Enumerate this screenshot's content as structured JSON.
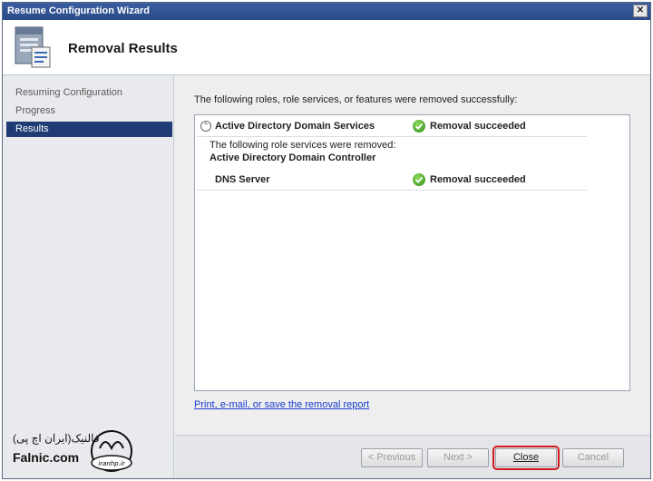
{
  "window": {
    "title": "Resume Configuration Wizard",
    "close_glyph": "✕"
  },
  "header": {
    "title": "Removal Results",
    "icon": "server-wizard-icon"
  },
  "sidebar": {
    "items": [
      {
        "label": "Resuming Configuration",
        "active": false
      },
      {
        "label": "Progress",
        "active": false
      },
      {
        "label": "Results",
        "active": true
      }
    ]
  },
  "main": {
    "intro": "The following roles, role services, or features were removed successfully:",
    "results": {
      "role_name": "Active Directory Domain Services",
      "role_status": "Removal succeeded",
      "sub_intro": "The following role services were removed:",
      "sub_service": "Active Directory Domain Controller",
      "feature_name": "DNS Server",
      "feature_status": "Removal succeeded",
      "collapse_glyph": "⌃"
    },
    "report_link": "Print, e-mail, or save the removal report"
  },
  "footer": {
    "previous": "< Previous",
    "next": "Next >",
    "close": "Close",
    "cancel": "Cancel"
  },
  "watermark": {
    "text_fa": "فالنیک(ایران اچ پی)",
    "text_en": "Falnic.com",
    "logo_text": "iranhp.ir"
  },
  "colors": {
    "accent": "#1f3c74",
    "title_bar": "#2a4a88",
    "success": "#2d8a1a",
    "highlight": "#d11a1a",
    "link": "#1a3ed0"
  }
}
